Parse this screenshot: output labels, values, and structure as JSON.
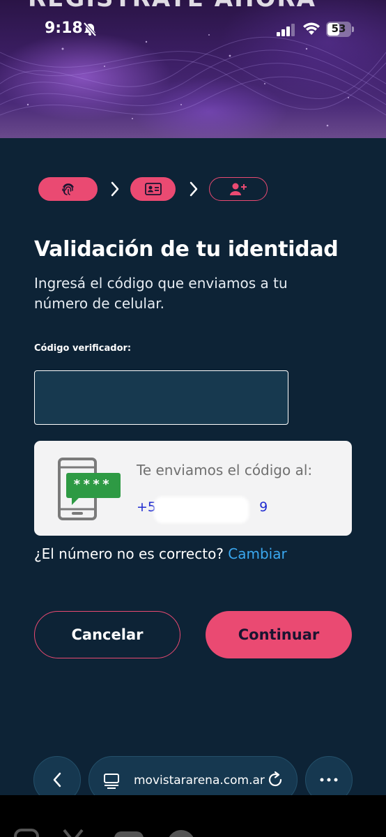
{
  "hero": {
    "title": "REGISTRATE AHORA"
  },
  "status_bar": {
    "time": "9:18",
    "battery": "53",
    "battery_level": 0.53
  },
  "stepper": {
    "current_step": 2,
    "total_steps": 3
  },
  "page": {
    "title": "Validación de tu identidad",
    "subtitle": "Ingresá el código que enviamos a tu número de celular."
  },
  "form": {
    "code_label": "Código verificador:",
    "code_value": ""
  },
  "info_card": {
    "sms_code_text": "****",
    "message": "Te enviamos el código al:",
    "phone_prefix": "+57",
    "phone_suffix": "9"
  },
  "change_number": {
    "question": "¿El número no es correcto?",
    "link": "Cambiar"
  },
  "buttons": {
    "cancel": "Cancelar",
    "continue": "Continuar"
  },
  "browser": {
    "url": "movistararena.com.ar"
  },
  "colors": {
    "background": "#0d2336",
    "accent": "#ea4a72",
    "link": "#3aa8f0",
    "input_bg": "#17394f",
    "card_bg": "#f3f3f4",
    "phone_number": "#1f2bd0"
  }
}
